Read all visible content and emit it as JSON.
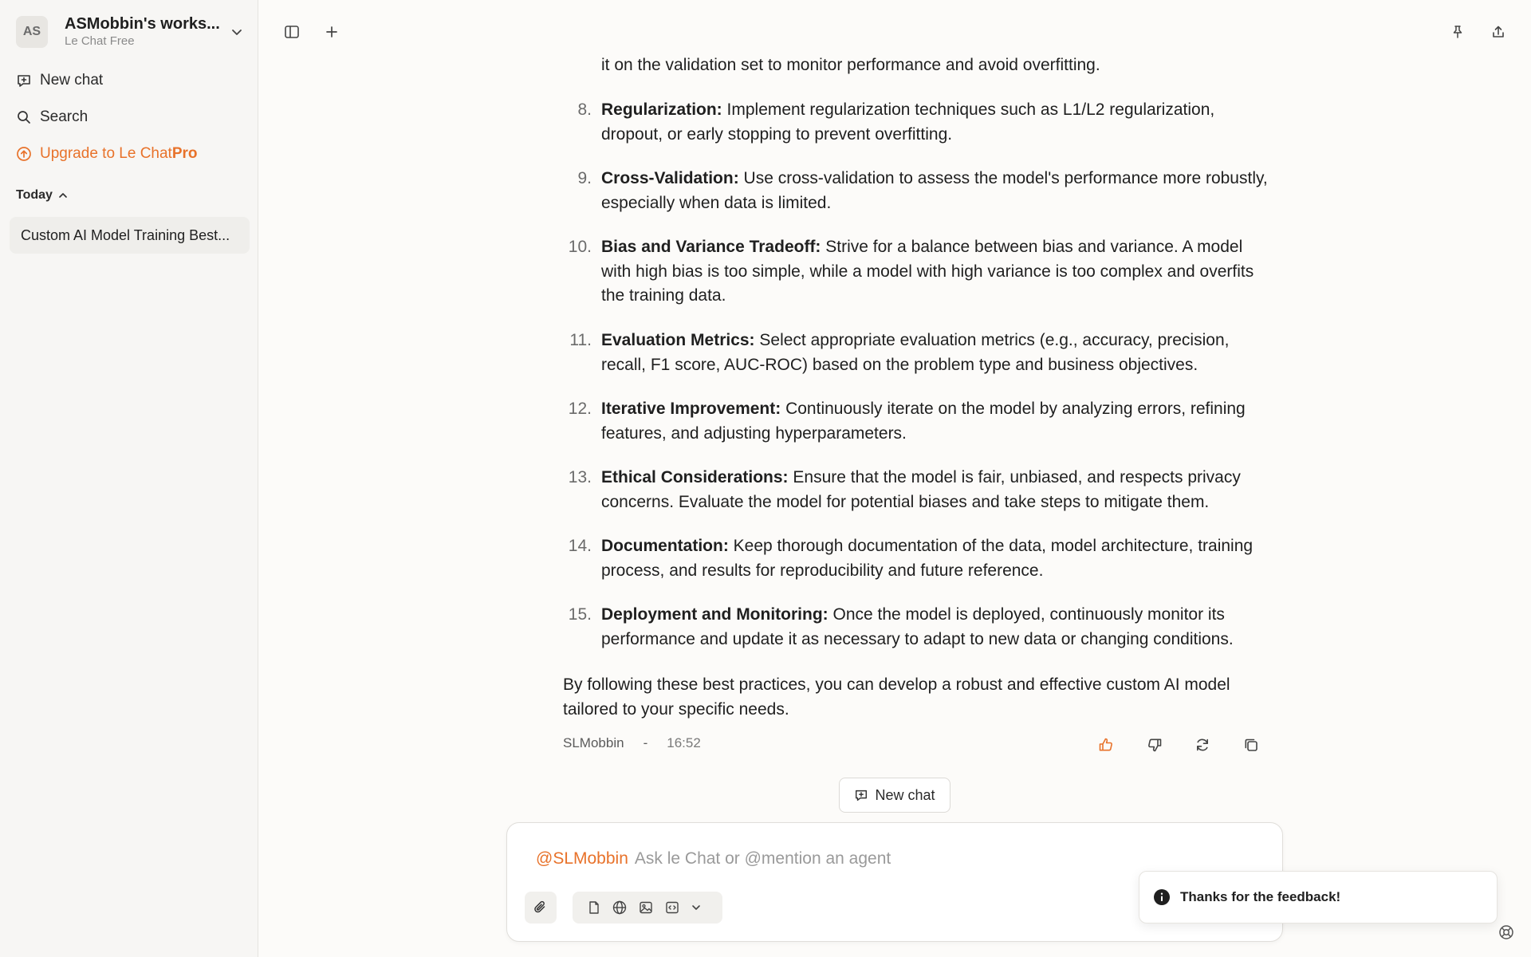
{
  "workspace": {
    "initials": "AS",
    "name": "ASMobbin's works...",
    "plan": "Le Chat Free"
  },
  "sidebar": {
    "new_chat": "New chat",
    "search": "Search",
    "upgrade_prefix": "Upgrade to Le Chat ",
    "upgrade_pro": "Pro",
    "section_today": "Today",
    "conversations": [
      {
        "title": "Custom AI Model Training Best..."
      }
    ]
  },
  "message": {
    "partial_line": "it on the validation set to monitor performance and avoid overfitting.",
    "items": [
      {
        "num": "8.",
        "title": "Regularization:",
        "text": " Implement regularization techniques such as L1/L2 regularization, dropout, or early stopping to prevent overfitting."
      },
      {
        "num": "9.",
        "title": "Cross-Validation:",
        "text": " Use cross-validation to assess the model's performance more robustly, especially when data is limited."
      },
      {
        "num": "10.",
        "title": "Bias and Variance Tradeoff:",
        "text": " Strive for a balance between bias and variance. A model with high bias is too simple, while a model with high variance is too complex and overfits the training data."
      },
      {
        "num": "11.",
        "title": "Evaluation Metrics:",
        "text": " Select appropriate evaluation metrics (e.g., accuracy, precision, recall, F1 score, AUC-ROC) based on the problem type and business objectives."
      },
      {
        "num": "12.",
        "title": "Iterative Improvement:",
        "text": " Continuously iterate on the model by analyzing errors, refining features, and adjusting hyperparameters."
      },
      {
        "num": "13.",
        "title": "Ethical Considerations:",
        "text": " Ensure that the model is fair, unbiased, and respects privacy concerns. Evaluate the model for potential biases and take steps to mitigate them."
      },
      {
        "num": "14.",
        "title": "Documentation:",
        "text": " Keep thorough documentation of the data, model architecture, training process, and results for reproducibility and future reference."
      },
      {
        "num": "15.",
        "title": "Deployment and Monitoring:",
        "text": " Once the model is deployed, continuously monitor its performance and update it as necessary to adapt to new data or changing conditions."
      }
    ],
    "closing": "By following these best practices, you can develop a robust and effective custom AI model tailored to your specific needs.",
    "author": "SLMobbin",
    "separator": "-",
    "time": "16:52"
  },
  "new_chat_pill": "New chat",
  "composer": {
    "mention": "@SLMobbin",
    "placeholder": "Ask le Chat or @mention an agent"
  },
  "toast": {
    "text": "Thanks for the feedback!"
  },
  "colors": {
    "accent": "#e8722a",
    "sidebar_bg": "#f7f6f4",
    "page_bg": "#fcfbf9"
  }
}
